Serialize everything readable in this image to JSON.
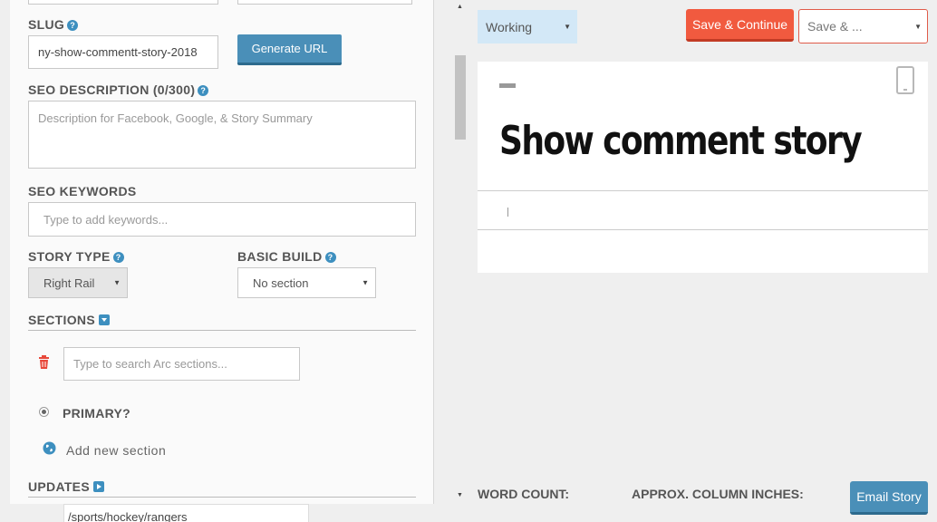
{
  "form": {
    "slug_label": "SLUG",
    "slug_value": "ny-show-commentt-story-2018",
    "generate_url_label": "Generate URL",
    "seo_description_label": "SEO DESCRIPTION (0/300)",
    "seo_description_placeholder": "Description for Facebook, Google, & Story Summary",
    "seo_keywords_label": "SEO KEYWORDS",
    "seo_keywords_placeholder": "Type to add keywords...",
    "story_type_label": "STORY TYPE",
    "story_type_value": "Right Rail",
    "basic_build_label": "BASIC BUILD",
    "basic_build_value": "No section",
    "sections_label": "SECTIONS",
    "section_search_placeholder": "Type to search Arc sections...",
    "primary_label": "PRIMARY?",
    "add_section_label": "Add new section",
    "updates_label": "UPDATES",
    "autocomplete_value": "/sports/hockey/rangers"
  },
  "toolbar": {
    "status_value": "Working",
    "save_continue_label": "Save & Continue",
    "save_menu_value": "Save & ..."
  },
  "editor": {
    "title": "Show comment story"
  },
  "footer": {
    "word_count_label": "WORD COUNT:",
    "column_inches_label": "APPROX. COLUMN INCHES:",
    "email_story_label": "Email Story"
  },
  "icons": {
    "help": "?",
    "caret": "▼",
    "scroll_up": "▲",
    "scroll_down": "▼"
  },
  "colors": {
    "accent_blue": "#4a8fb8",
    "save_red": "#f15a3f",
    "status_bg": "#d3e8f7",
    "delete_red": "#e8483a"
  }
}
